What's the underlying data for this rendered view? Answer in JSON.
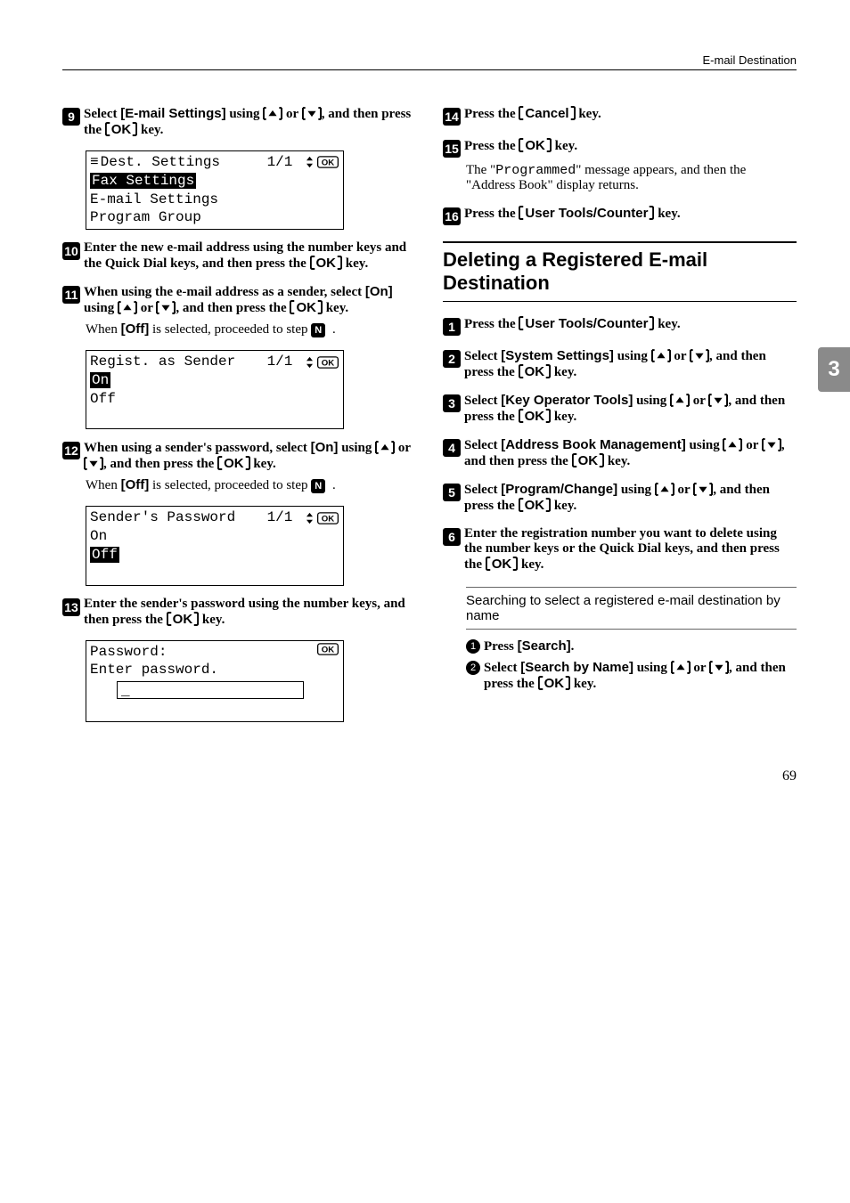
{
  "header": {
    "section_title": "E-mail Destination"
  },
  "side_tab": "3",
  "page_number": "69",
  "left": {
    "step9": {
      "num": "9",
      "text_a": "Select ",
      "bold_a": "[E-mail Settings]",
      "text_b": " using ",
      "text_c": " or ",
      "text_d": ", and then press the ",
      "key_ok": "OK",
      "text_e": " key."
    },
    "lcd1": {
      "top_left_icon": "≡",
      "top_left": "Dest. Settings",
      "top_right_a": "1/1",
      "row1": "Fax Settings",
      "row2": "E-mail Settings",
      "row3": "Program Group"
    },
    "step10": {
      "num": "10",
      "text": "Enter the new e-mail address using the number keys and the Quick Dial keys, and then press the ",
      "key_ok": "OK",
      "text_end": " key."
    },
    "step11": {
      "num": "11",
      "text_a": "When using the e-mail address as a sender, select ",
      "bold_a": "[On]",
      "text_b": " using ",
      "text_c": " or ",
      "text_d": ", and then press the ",
      "key_ok": "OK",
      "text_e": " key.",
      "note_a": "When ",
      "note_bold": "[Off]",
      "note_b": " is selected, proceeded to step ",
      "note_step": "N",
      "note_c": " ."
    },
    "lcd2": {
      "top_left": "Regist. as Sender",
      "top_right": "1/1",
      "row1": "On",
      "row2": "Off"
    },
    "step12": {
      "num": "12",
      "text_a": "When using a sender's password, select ",
      "bold_a": "[On]",
      "text_b": " using ",
      "text_c": " or ",
      "text_d": ", and then press the ",
      "key_ok": "OK",
      "text_e": " key.",
      "note_a": "When ",
      "note_bold": "[Off]",
      "note_b": " is selected, proceeded to step ",
      "note_step": "N",
      "note_c": " ."
    },
    "lcd3": {
      "top_left": "Sender's Password",
      "top_right": "1/1",
      "row1": "On",
      "row2": "Off"
    },
    "step13": {
      "num": "13",
      "text": "Enter the sender's password using the number keys, and then press the ",
      "key_ok": "OK",
      "text_end": " key."
    },
    "lcd4": {
      "top_left": "Password:",
      "top_right": "OK",
      "row1": "Enter password.",
      "input": "_"
    }
  },
  "right": {
    "step14": {
      "num": "14",
      "text_a": "Press the ",
      "key": "Cancel",
      "text_b": " key."
    },
    "step15": {
      "num": "15",
      "text_a": "Press the ",
      "key": "OK",
      "text_b": " key.",
      "desc_a": "The \"",
      "tty": "Programmed",
      "desc_b": "\" message appears, and then the \"Address Book\" display returns."
    },
    "step16": {
      "num": "16",
      "text_a": "Press the ",
      "key": "User Tools/Counter",
      "text_b": " key."
    },
    "section_title": "Deleting a Registered E-mail Destination",
    "d1": {
      "num": "1",
      "text_a": "Press the ",
      "key": "User Tools/Counter",
      "text_b": " key."
    },
    "d2": {
      "num": "2",
      "text_a": "Select ",
      "bold": "[System Settings]",
      "text_b": " using ",
      "text_c": " or ",
      "text_d": ", and then press the ",
      "key": "OK",
      "text_e": " key."
    },
    "d3": {
      "num": "3",
      "text_a": "Select ",
      "bold": "[Key Operator Tools]",
      "text_b": " using ",
      "text_c": " or ",
      "text_d": ", and then press the ",
      "key": "OK",
      "text_e": " key."
    },
    "d4": {
      "num": "4",
      "text_a": "Select ",
      "bold": "[Address Book Management]",
      "text_b": " using ",
      "text_c": " or ",
      "text_d": ", and then press the ",
      "key": "OK",
      "text_e": " key."
    },
    "d5": {
      "num": "5",
      "text_a": "Select ",
      "bold": "[Program/Change]",
      "text_b": " using ",
      "text_c": " or ",
      "text_d": ", and then press the ",
      "key": "OK",
      "text_e": " key."
    },
    "d6": {
      "num": "6",
      "text": "Enter the registration number you want to delete using the number keys or the Quick Dial keys, and then press the ",
      "key": "OK",
      "text_end": " key."
    },
    "inset_title": "Searching to select a registered e-mail destination by name",
    "sub1": {
      "num": "1",
      "text_a": "Press ",
      "bold": "[Search]",
      "text_b": "."
    },
    "sub2": {
      "num": "2",
      "text_a": "Select ",
      "bold": "[Search by Name]",
      "text_b": " using ",
      "text_c": " or ",
      "text_d": ", and then press the ",
      "key": "OK",
      "text_e": " key."
    }
  }
}
